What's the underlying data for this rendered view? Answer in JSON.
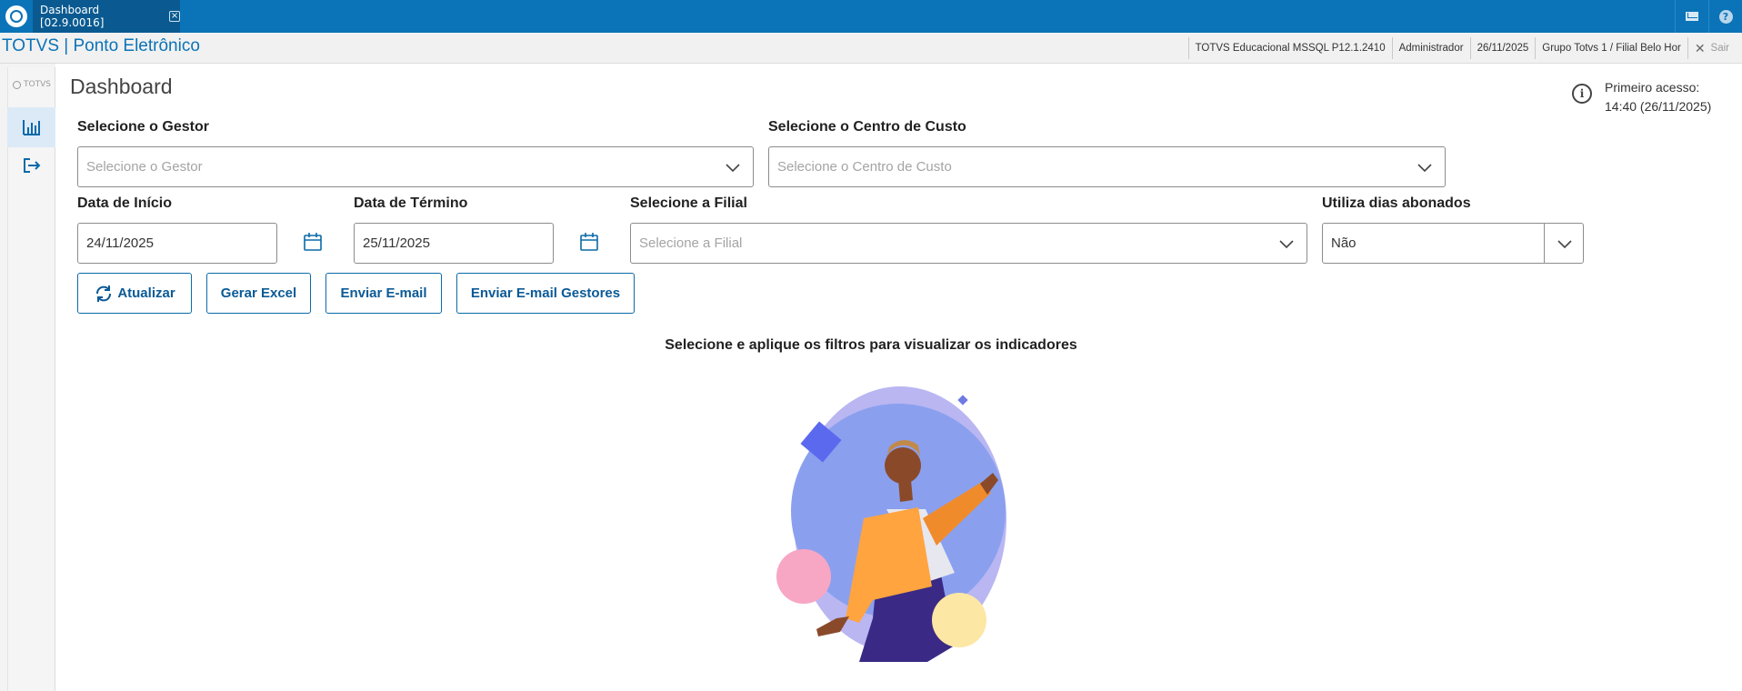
{
  "window": {
    "tab_title": "Dashboard [02.9.0016]",
    "product_title": "TOTVS | Ponto Eletrônico"
  },
  "status": {
    "system": "TOTVS Educacional MSSQL P12.1.2410",
    "user": "Administrador",
    "date": "26/11/2025",
    "branch": "Grupo Totvs 1 / Filial Belo Hor",
    "exit_label": "Sair"
  },
  "rail": {
    "logo_text": "TOTVS"
  },
  "page": {
    "title": "Dashboard",
    "first_access_label": "Primeiro acesso:",
    "first_access_value": "14:40 (26/11/2025)"
  },
  "filters": {
    "gestor_label": "Selecione o Gestor",
    "gestor_placeholder": "Selecione o Gestor",
    "centro_label": "Selecione o Centro de Custo",
    "centro_placeholder": "Selecione o Centro de Custo",
    "inicio_label": "Data de Início",
    "inicio_value": "24/11/2025",
    "termino_label": "Data de Término",
    "termino_value": "25/11/2025",
    "filial_label": "Selecione a Filial",
    "filial_placeholder": "Selecione a Filial",
    "abonados_label": "Utiliza dias abonados",
    "abonados_value": "Não"
  },
  "actions": {
    "atualizar": "Atualizar",
    "gerar_excel": "Gerar Excel",
    "enviar_email": "Enviar E-mail",
    "enviar_email_gestores": "Enviar E-mail Gestores"
  },
  "empty_state": {
    "message": "Selecione e aplique os filtros para visualizar os indicadores"
  },
  "colors": {
    "brand_blue": "#0b73b7",
    "button_text": "#0b5a96"
  }
}
